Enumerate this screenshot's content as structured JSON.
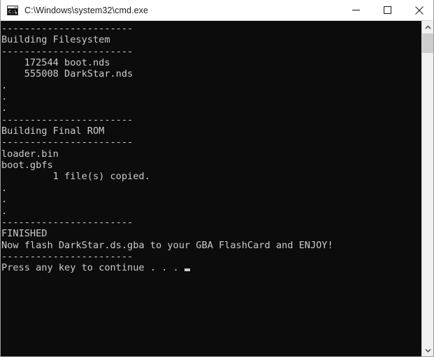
{
  "window": {
    "title": "C:\\Windows\\system32\\cmd.exe",
    "icon": "cmd-console-icon",
    "background_color": "#0c0c0c",
    "text_color": "#cccccc",
    "titlebar_color": "#ffffff"
  },
  "titlebar_buttons": {
    "minimize_label": "Minimize",
    "maximize_label": "Maximize",
    "close_label": "Close"
  },
  "console": {
    "lines": [
      "-----------------------",
      "Building Filesystem",
      "-----------------------",
      "    172544 boot.nds",
      "    555008 DarkStar.nds",
      ".",
      ".",
      ".",
      "-----------------------",
      "Building Final ROM",
      "-----------------------",
      "loader.bin",
      "boot.gbfs",
      "         1 file(s) copied.",
      ".",
      ".",
      ".",
      "-----------------------",
      "FINISHED",
      "Now flash DarkStar.ds.gba to your GBA FlashCard and ENJOY!",
      "-----------------------",
      "Press any key to continue . . . "
    ],
    "cursor_visible": true
  },
  "scrollbar": {
    "up_arrow": "chevron-up-icon",
    "down_arrow": "chevron-down-icon",
    "thumb_color": "#cdcdcd",
    "track_color": "#f0f0f0"
  }
}
